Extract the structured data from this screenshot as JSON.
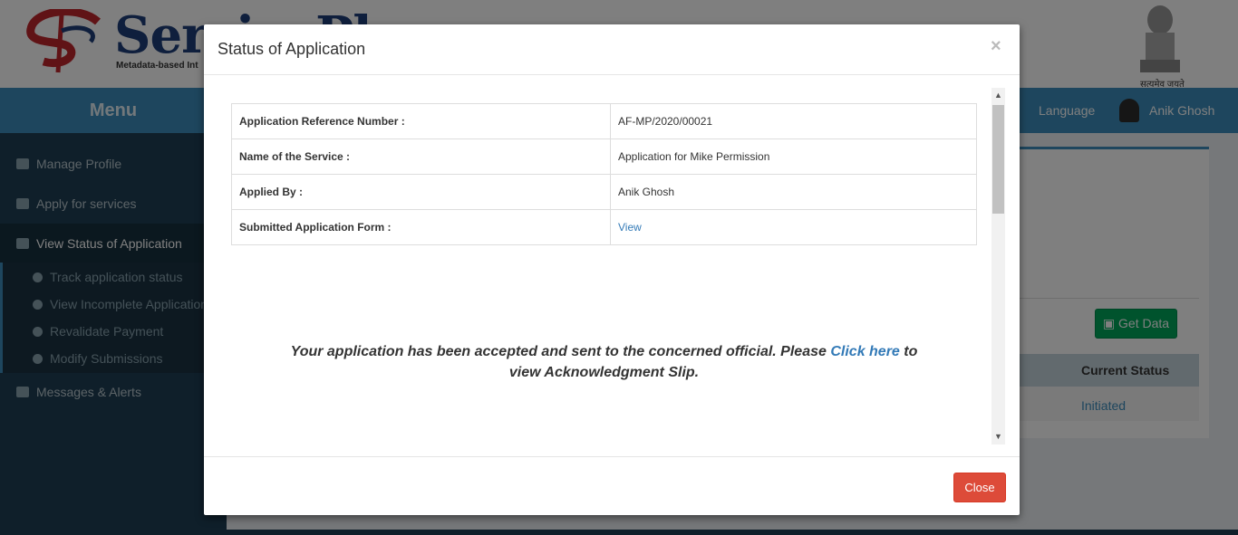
{
  "header": {
    "logo_text": "ServicePlus",
    "logo_subtitle": "Metadata-based Int",
    "emblem_caption": "सत्यमेव जयते",
    "language": "Language",
    "user_name": "Anik Ghosh"
  },
  "sidebar": {
    "menu_title": "Menu",
    "items": [
      {
        "label": "Manage Profile"
      },
      {
        "label": "Apply for services"
      },
      {
        "label": "View Status of Application"
      },
      {
        "label": "Messages & Alerts"
      }
    ],
    "sub_items": [
      {
        "label": "Track application status"
      },
      {
        "label": "View Incomplete Application"
      },
      {
        "label": "Revalidate Payment"
      },
      {
        "label": "Modify Submissions"
      }
    ]
  },
  "main": {
    "get_data_button": "Get Data",
    "table_header_status": "Current Status",
    "table_cell_status": "Initiated"
  },
  "modal": {
    "title": "Status of Application",
    "close_x": "×",
    "rows": [
      {
        "label": "Application Reference Number :",
        "value": "AF-MP/2020/00021"
      },
      {
        "label": "Name of the Service :",
        "value": "Application for Mike Permission"
      },
      {
        "label": "Applied By :",
        "value": "Anik Ghosh"
      },
      {
        "label": "Submitted Application Form :",
        "value": "View"
      }
    ],
    "message_part1": "Your application has been accepted and sent to the concerned official. Please",
    "message_link": "Click here",
    "message_part2": "to view Acknowledgment Slip.",
    "close_button": "Close"
  }
}
